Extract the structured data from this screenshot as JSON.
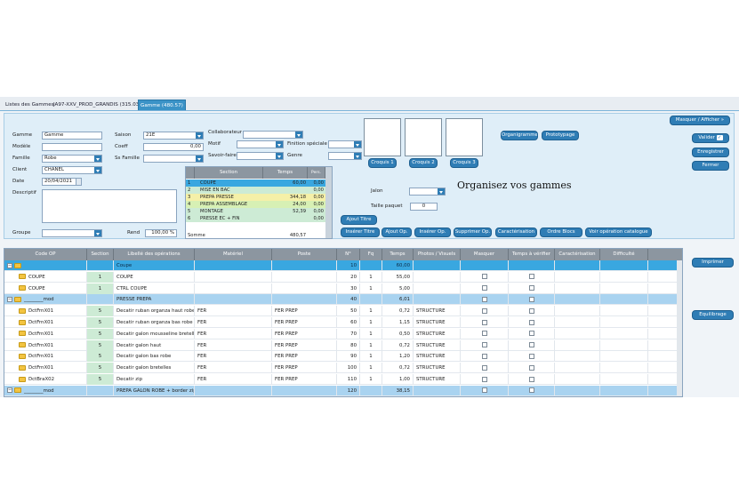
{
  "tabs": [
    "Listes des Gammes",
    "JA97-XXV_PROD_GRANDIS (315.03)",
    "Gamme (480.57)"
  ],
  "header": {
    "gamme_label": "Gamme",
    "gamme_value": "Gamme",
    "modele_label": "Modèle",
    "modele_value": "",
    "famille_label": "Famille",
    "famille_value": "Robe",
    "client_label": "Client",
    "client_value": "CHANEL",
    "date_label": "Date",
    "date_value": "20/04/2021",
    "descriptif_label": "Descriptif",
    "groupe_label": "Groupe",
    "rend_label": "Rend",
    "rend_value": "100,00 %",
    "saison_label": "Saison",
    "saison_value": "21E",
    "coeff_label": "Coeff",
    "coeff_value": "0,00",
    "ssfamille_label": "Ss Famille",
    "collaborateur_label": "Collaborateur",
    "motif_label": "Motif",
    "savoirfaire_label": "Savoir-faire",
    "finition_label": "Finition spéciale",
    "genre_label": "Genre",
    "jalon_label": "Jalon",
    "taille_label": "Taille paquet",
    "taille_value": "0",
    "heading": "Organisez vos gammes"
  },
  "buttons": {
    "masquer": "Masquer / Afficher",
    "valider": "Valider",
    "enregistrer": "Enregistrer",
    "fermer": "Fermer",
    "organigramme": "Organigramme",
    "prototypage": "Prototypage",
    "croquis1": "Croquis 1",
    "croquis2": "Croquis 2",
    "croquis3": "Croquis 3",
    "ajout_titre": "Ajout Titre",
    "inserer_titre": "Insérer Titre",
    "ajout_op": "Ajout Op.",
    "inserer_op": "Insérer Op.",
    "supprimer_op": "Supprimer Op.",
    "caracterisation": "Caractérisation",
    "ordre_blocs": "Ordre Blocs",
    "voir_catalogue": "Voir opération catalogue",
    "imprimer": "Imprimer",
    "equilibrage": "Equilibrage"
  },
  "sections": {
    "headers": [
      "Section",
      "Temps",
      "Pers."
    ],
    "rows": [
      {
        "n": "1",
        "name": "COUPE",
        "temps": "60,00",
        "pers": "0,00",
        "color": "#39a7e0"
      },
      {
        "n": "2",
        "name": "MISE EN BAC",
        "temps": "",
        "pers": "0,00",
        "color": "#cdebd5"
      },
      {
        "n": "3",
        "name": "PREPA PRESSE",
        "temps": "344,18",
        "pers": "0,00",
        "color": "#f5f0a8"
      },
      {
        "n": "4",
        "name": "PREPA ASSEMBLAGE",
        "temps": "24,00",
        "pers": "0,00",
        "color": "#d7f0b4"
      },
      {
        "n": "5",
        "name": "MONTAGE",
        "temps": "52,39",
        "pers": "0,00",
        "color": "#cdebd5"
      },
      {
        "n": "6",
        "name": "PRESSE EC + FIN",
        "temps": "",
        "pers": "0,00",
        "color": "#cdebd5"
      }
    ],
    "somme_label": "Somme",
    "somme_value": "480,57"
  },
  "grid": {
    "headers": [
      "Code OP",
      "Section",
      "Libellé des opérations",
      "Matériel",
      "Poste",
      "N°",
      "Fq",
      "Temps",
      "Photos / Visuels",
      "Masquer",
      "Temps à vérifier",
      "Caractérisation",
      "Difficulté"
    ],
    "rows": [
      {
        "type": "sel",
        "code": "",
        "section": "",
        "libelle": "Coupe",
        "materiel": "",
        "poste": "",
        "n": "10",
        "fq": "",
        "temps": "60,00",
        "photo": ""
      },
      {
        "type": "op",
        "code": "COUPE",
        "section": "1",
        "libelle": "COUPE",
        "materiel": "",
        "poste": "",
        "n": "20",
        "fq": "1",
        "temps": "55,00",
        "photo": ""
      },
      {
        "type": "op",
        "code": "COUPE",
        "section": "1",
        "libelle": "CTRL COUPE",
        "materiel": "",
        "poste": "",
        "n": "30",
        "fq": "1",
        "temps": "5,00",
        "photo": ""
      },
      {
        "type": "hdr",
        "code": "________mod",
        "section": "",
        "libelle": "PRESSE PREPA",
        "materiel": "",
        "poste": "",
        "n": "40",
        "fq": "",
        "temps": "6,01",
        "photo": ""
      },
      {
        "type": "op",
        "code": "DctFrnX01",
        "section": "5",
        "libelle": "Decatir ruban organza haut robe",
        "materiel": "FER",
        "poste": "FER PREP",
        "n": "50",
        "fq": "1",
        "temps": "0,72",
        "photo": "STRUCTURE"
      },
      {
        "type": "op",
        "code": "DctFrnX01",
        "section": "5",
        "libelle": "Decatir ruban organza bas robe",
        "materiel": "FER",
        "poste": "FER PREP",
        "n": "60",
        "fq": "1",
        "temps": "1,15",
        "photo": "STRUCTURE"
      },
      {
        "type": "op",
        "code": "DctFrnX01",
        "section": "5",
        "libelle": "Decatir galon mousseline bretelles",
        "materiel": "FER",
        "poste": "FER PREP",
        "n": "70",
        "fq": "1",
        "temps": "0,50",
        "photo": "STRUCTURE"
      },
      {
        "type": "op",
        "code": "DctFrnX01",
        "section": "5",
        "libelle": "Decatir galon haut",
        "materiel": "FER",
        "poste": "FER PREP",
        "n": "80",
        "fq": "1",
        "temps": "0,72",
        "photo": "STRUCTURE"
      },
      {
        "type": "op",
        "code": "DctFrnX01",
        "section": "5",
        "libelle": "Decatir galon bas robe",
        "materiel": "FER",
        "poste": "FER PREP",
        "n": "90",
        "fq": "1",
        "temps": "1,20",
        "photo": "STRUCTURE"
      },
      {
        "type": "op",
        "code": "DctFrnX01",
        "section": "5",
        "libelle": "Decatir galon bretelles",
        "materiel": "FER",
        "poste": "FER PREP",
        "n": "100",
        "fq": "1",
        "temps": "0,72",
        "photo": "STRUCTURE"
      },
      {
        "type": "op",
        "code": "DctBraX02",
        "section": "5",
        "libelle": "Decatir zip",
        "materiel": "FER",
        "poste": "FER PREP",
        "n": "110",
        "fq": "1",
        "temps": "1,00",
        "photo": "STRUCTURE"
      },
      {
        "type": "hdr",
        "code": "________mod",
        "section": "",
        "libelle": "PREPA GALON ROBE + border zip",
        "materiel": "",
        "poste": "",
        "n": "120",
        "fq": "",
        "temps": "38,15",
        "photo": ""
      }
    ]
  },
  "colors": {
    "accent": "#2f7db5",
    "selected": "#39a7e0",
    "group": "#a9d3f0",
    "header": "#8c96a0",
    "section_cell": "#cdebd5"
  }
}
